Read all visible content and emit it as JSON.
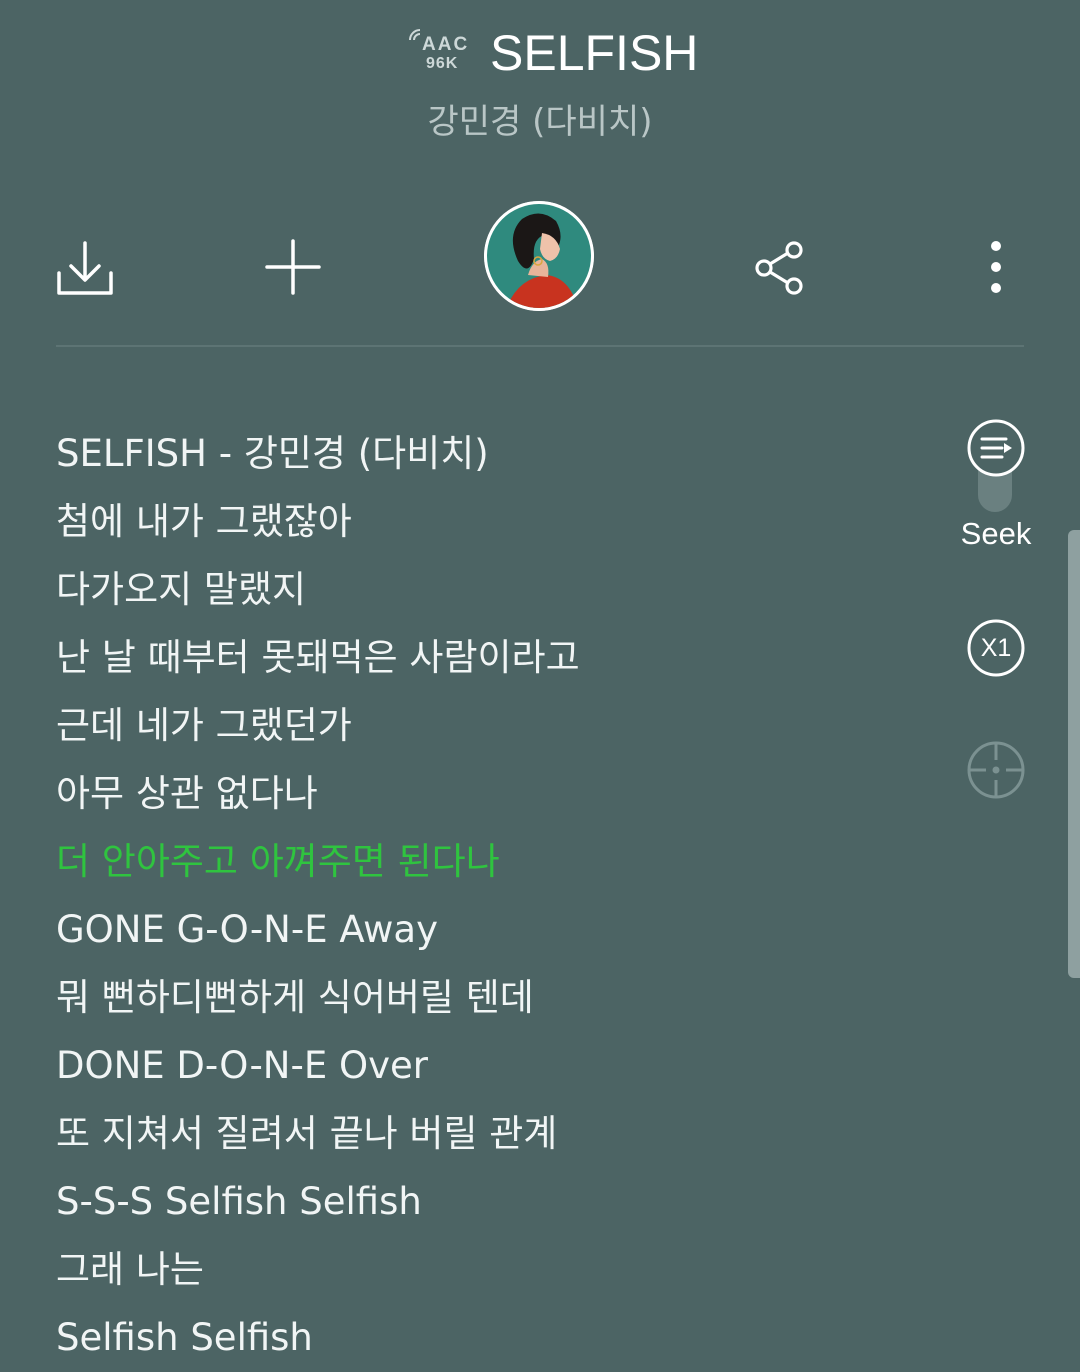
{
  "header": {
    "quality_codec": "AAC",
    "quality_rate": "96K",
    "song_title": "SELFISH",
    "artist": "강민경 (다비치)"
  },
  "toolbar": {
    "icons": [
      "download-icon",
      "add-icon",
      "album-art",
      "share-icon",
      "more-icon"
    ]
  },
  "lyrics": [
    "SELFISH - 강민경 (다비치)",
    "첨에 내가 그랬잖아",
    "다가오지 말랬지",
    "난 날 때부터 못돼먹은 사람이라고",
    "근데 네가 그랬던가",
    "아무 상관 없다나",
    "더 안아주고 아껴주면 된다나",
    "GONE G-O-N-E Away",
    "뭐 뻔하디뻔하게 식어버릴 텐데",
    "DONE D-O-N-E Over",
    "또 지쳐서 질려서 끝나 버릴 관계",
    "S-S-S Selfish Selfish",
    "그래 나는",
    "Selfish Selfish"
  ],
  "active_lyric_index": 6,
  "side_controls": {
    "seek_label": "Seek",
    "speed_label": "X1"
  },
  "colors": {
    "background": "#4c6464",
    "active_lyric": "#2fc43f",
    "text": "#f1f5f5",
    "subtext": "#b9c6c6"
  }
}
